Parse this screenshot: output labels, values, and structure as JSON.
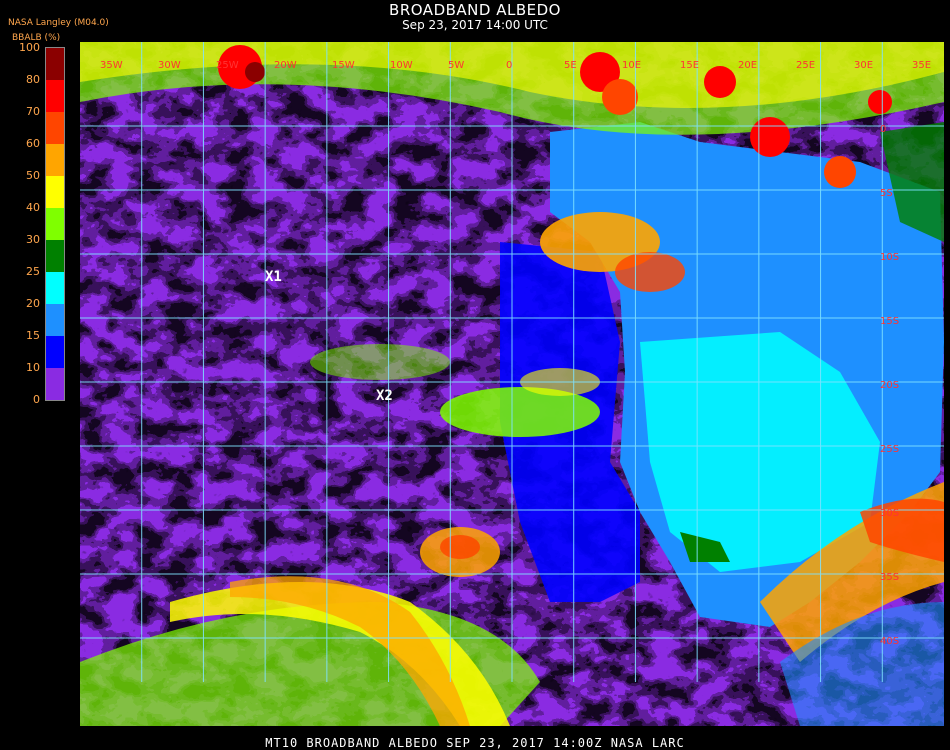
{
  "header": {
    "title": "BROADBAND ALBEDO",
    "subtitle": "Sep 23, 2017 14:00 UTC",
    "org": "NASA Langley (M04.0)",
    "units": "BBALB (%)"
  },
  "colorbar": {
    "ticks": [
      "100",
      "80",
      "70",
      "60",
      "50",
      "40",
      "30",
      "25",
      "20",
      "15",
      "10",
      "0"
    ],
    "bins": [
      {
        "label": "0-10",
        "color": "#8a2be2"
      },
      {
        "label": "10-15",
        "color": "#0000ff"
      },
      {
        "label": "15-20",
        "color": "#1e90ff"
      },
      {
        "label": "20-25",
        "color": "#00ffff"
      },
      {
        "label": "25-30",
        "color": "#008000"
      },
      {
        "label": "30-40",
        "color": "#7fff00"
      },
      {
        "label": "40-50",
        "color": "#ffff00"
      },
      {
        "label": "50-60",
        "color": "#ffa500"
      },
      {
        "label": "60-70",
        "color": "#ff4500"
      },
      {
        "label": "70-80",
        "color": "#ff0000"
      },
      {
        "label": "80-100",
        "color": "#8b0000"
      }
    ]
  },
  "map": {
    "markers": [
      {
        "label": "X1"
      },
      {
        "label": "X2"
      }
    ],
    "lon_labels": [
      "35W",
      "30W",
      "25W",
      "20W",
      "15W",
      "10W",
      "5W",
      "0",
      "5E",
      "10E",
      "15E",
      "20E",
      "25E",
      "30E",
      "35E"
    ],
    "lat_labels": [
      "0",
      "5S",
      "10S",
      "15S",
      "20S",
      "25S",
      "30S",
      "35S",
      "40S"
    ]
  },
  "footer": {
    "text": "MT10  BROADBAND ALBEDO  SEP 23, 2017 14:00Z  NASA LARC"
  }
}
